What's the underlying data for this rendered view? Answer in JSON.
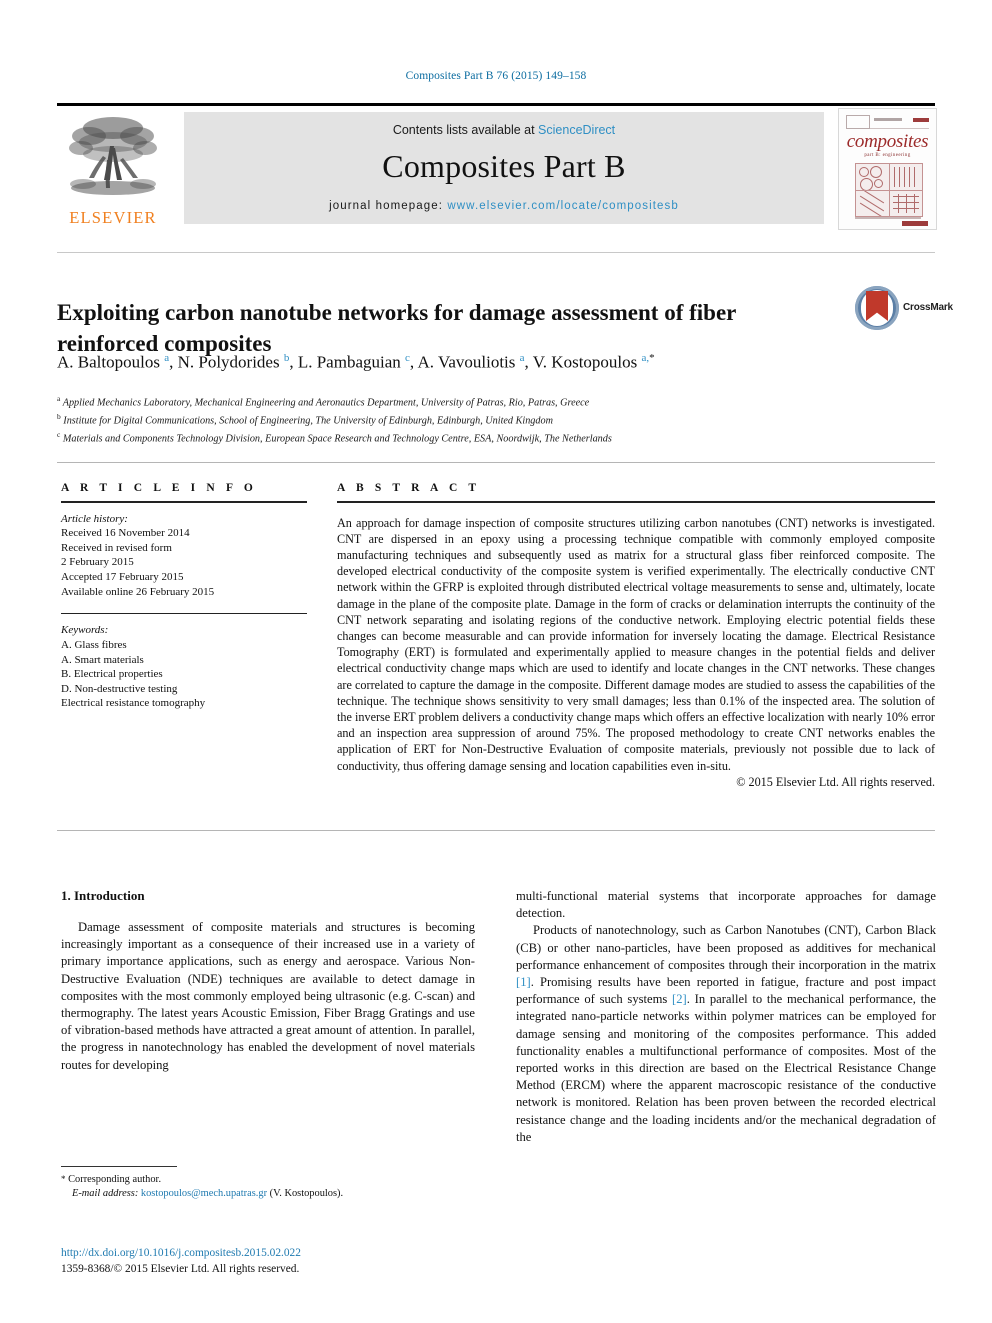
{
  "running_head": "Composites Part B 76 (2015) 149–158",
  "masthead": {
    "publisher_name": "ELSEVIER",
    "contents_prefix": "Contents lists available at ",
    "contents_link": "ScienceDirect",
    "journal_name": "Composites Part B",
    "homepage_prefix": "journal homepage: ",
    "homepage_url": "www.elsevier.com/locate/compositesb",
    "cover": {
      "title": "composites",
      "subtitle": "part B: engineering"
    }
  },
  "article": {
    "title": "Exploiting carbon nanotube networks for damage assessment of fiber reinforced composites",
    "crossmark_label": "CrossMark",
    "authors_html": "A. Baltopoulos <sup>a</sup>, N. Polydorides <sup>b</sup>, L. Pambaguian <sup>c</sup>, A. Vavouliotis <sup>a</sup>, V. Kostopoulos <sup>a,</sup><sup class=\"star\">*</sup>",
    "affiliations": [
      "Applied Mechanics Laboratory, Mechanical Engineering and Aeronautics Department, University of Patras, Rio, Patras, Greece",
      "Institute for Digital Communications, School of Engineering, The University of Edinburgh, Edinburgh, United Kingdom",
      "Materials and Components Technology Division, European Space Research and Technology Centre, ESA, Noordwijk, The Netherlands"
    ],
    "affiliation_marks": [
      "a",
      "b",
      "c"
    ]
  },
  "article_info": {
    "heading": "A R T I C L E   I N F O",
    "history_label": "Article history:",
    "history": [
      "Received 16 November 2014",
      "Received in revised form",
      "2 February 2015",
      "Accepted 17 February 2015",
      "Available online 26 February 2015"
    ],
    "keywords_label": "Keywords:",
    "keywords": [
      "A. Glass fibres",
      "A. Smart materials",
      "B. Electrical properties",
      "D. Non-destructive testing",
      "Electrical resistance tomography"
    ]
  },
  "abstract": {
    "heading": "A B S T R A C T",
    "text": "An approach for damage inspection of composite structures utilizing carbon nanotubes (CNT) networks is investigated. CNT are dispersed in an epoxy using a processing technique compatible with commonly employed composite manufacturing techniques and subsequently used as matrix for a structural glass fiber reinforced composite. The developed electrical conductivity of the composite system is verified experimentally. The electrically conductive CNT network within the GFRP is exploited through distributed electrical voltage measurements to sense and, ultimately, locate damage in the plane of the composite plate. Damage in the form of cracks or delamination interrupts the continuity of the CNT network separating and isolating regions of the conductive network. Employing electric potential fields these changes can become measurable and can provide information for inversely locating the damage. Electrical Resistance Tomography (ERT) is formulated and experimentally applied to measure changes in the potential fields and deliver electrical conductivity change maps which are used to identify and locate changes in the CNT networks. These changes are correlated to capture the damage in the composite. Different damage modes are studied to assess the capabilities of the technique. The technique shows sensitivity to very small damages; less than 0.1% of the inspected area. The solution of the inverse ERT problem delivers a conductivity change maps which offers an effective localization with nearly 10% error and an inspection area suppression of around 75%. The proposed methodology to create CNT networks enables the application of ERT for Non-Destructive Evaluation of composite materials, previously not possible due to lack of conductivity, thus offering damage sensing and location capabilities even in-situ.",
    "copyright": "© 2015 Elsevier Ltd. All rights reserved."
  },
  "introduction": {
    "section_number_title": "1. Introduction",
    "left_paragraph": "Damage assessment of composite materials and structures is becoming increasingly important as a consequence of their increased use in a variety of primary importance applications, such as energy and aerospace. Various Non-Destructive Evaluation (NDE) techniques are available to detect damage in composites with the most commonly employed being ultrasonic (e.g. C-scan) and thermography. The latest years Acoustic Emission, Fiber Bragg Gratings and use of vibration-based methods have attracted a great amount of attention. In parallel, the progress in nanotechnology has enabled the development of novel materials routes for developing",
    "right_paragraph_1": "multi-functional material systems that incorporate approaches for damage detection.",
    "right_paragraph_2_part1": "Products of nanotechnology, such as Carbon Nanotubes (CNT), Carbon Black (CB) or other nano-particles, have been proposed as additives for mechanical performance enhancement of composites through their incorporation in the matrix ",
    "right_citation_1": "[1]",
    "right_paragraph_2_part2": ". Promising results have been reported in fatigue, fracture and post impact performance of such systems ",
    "right_citation_2": "[2]",
    "right_paragraph_2_part3": ". In parallel to the mechanical performance, the integrated nano-particle networks within polymer matrices can be employed for damage sensing and monitoring of the composites performance. This added functionality enables a multifunctional performance of composites. Most of the reported works in this direction are based on the Electrical Resistance Change Method (ERCM) where the apparent macroscopic resistance of the conductive network is monitored. Relation has been proven between the recorded electrical resistance change and the loading incidents and/or the mechanical degradation of the"
  },
  "footer": {
    "corresponding_star": "*",
    "corresponding_label": "Corresponding author.",
    "email_label": "E-mail address:",
    "email": "kostopoulos@mech.upatras.gr",
    "email_owner": "(V. Kostopoulos).",
    "doi": "http://dx.doi.org/10.1016/j.compositesb.2015.02.022",
    "issn_line": "1359-8368/© 2015 Elsevier Ltd. All rights reserved."
  },
  "colors": {
    "link_blue": "#2f8fc4",
    "running_head_blue": "#0b6ca0",
    "elsevier_orange": "#f08020",
    "cover_red": "#9c2b2b",
    "crossmark_red": "#c0392b",
    "crossmark_blue": "#5b7fa6"
  }
}
